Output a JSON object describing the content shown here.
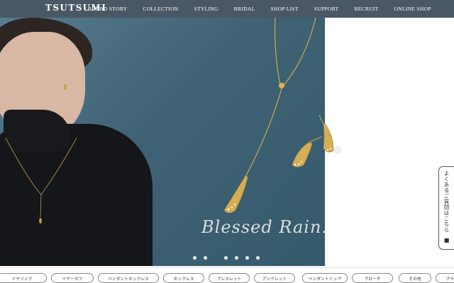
{
  "header": {
    "logo": "TSUTSUMI",
    "nav": [
      {
        "label": "BRAND STORY"
      },
      {
        "label": "COLLECTION"
      },
      {
        "label": "STYLING"
      },
      {
        "label": "BRIDAL"
      },
      {
        "label": "SHOP LIST"
      },
      {
        "label": "SUPPORT"
      },
      {
        "label": "RECRUIT"
      },
      {
        "label": "ONLINE SHOP"
      }
    ]
  },
  "hero": {
    "script_title": "Blessed Rain.",
    "slide_count": 6,
    "active_slide": 0
  },
  "faq_tab": {
    "label": "よくあるご質問はこちら"
  },
  "categories": [
    {
      "label": "イヤリング"
    },
    {
      "label": "イヤーカフ"
    },
    {
      "label": "ペンダントネックレス"
    },
    {
      "label": "ネックレス"
    },
    {
      "label": "ブレスレット"
    },
    {
      "label": "アンクレット"
    },
    {
      "label": "ペンダントトップ"
    },
    {
      "label": "ブローチ"
    },
    {
      "label": "その他"
    },
    {
      "label": "ブラ"
    }
  ],
  "colors": {
    "nav_bg": "#4a5866",
    "hero_bg": "#3f6375",
    "gold": "#c9a24a"
  }
}
